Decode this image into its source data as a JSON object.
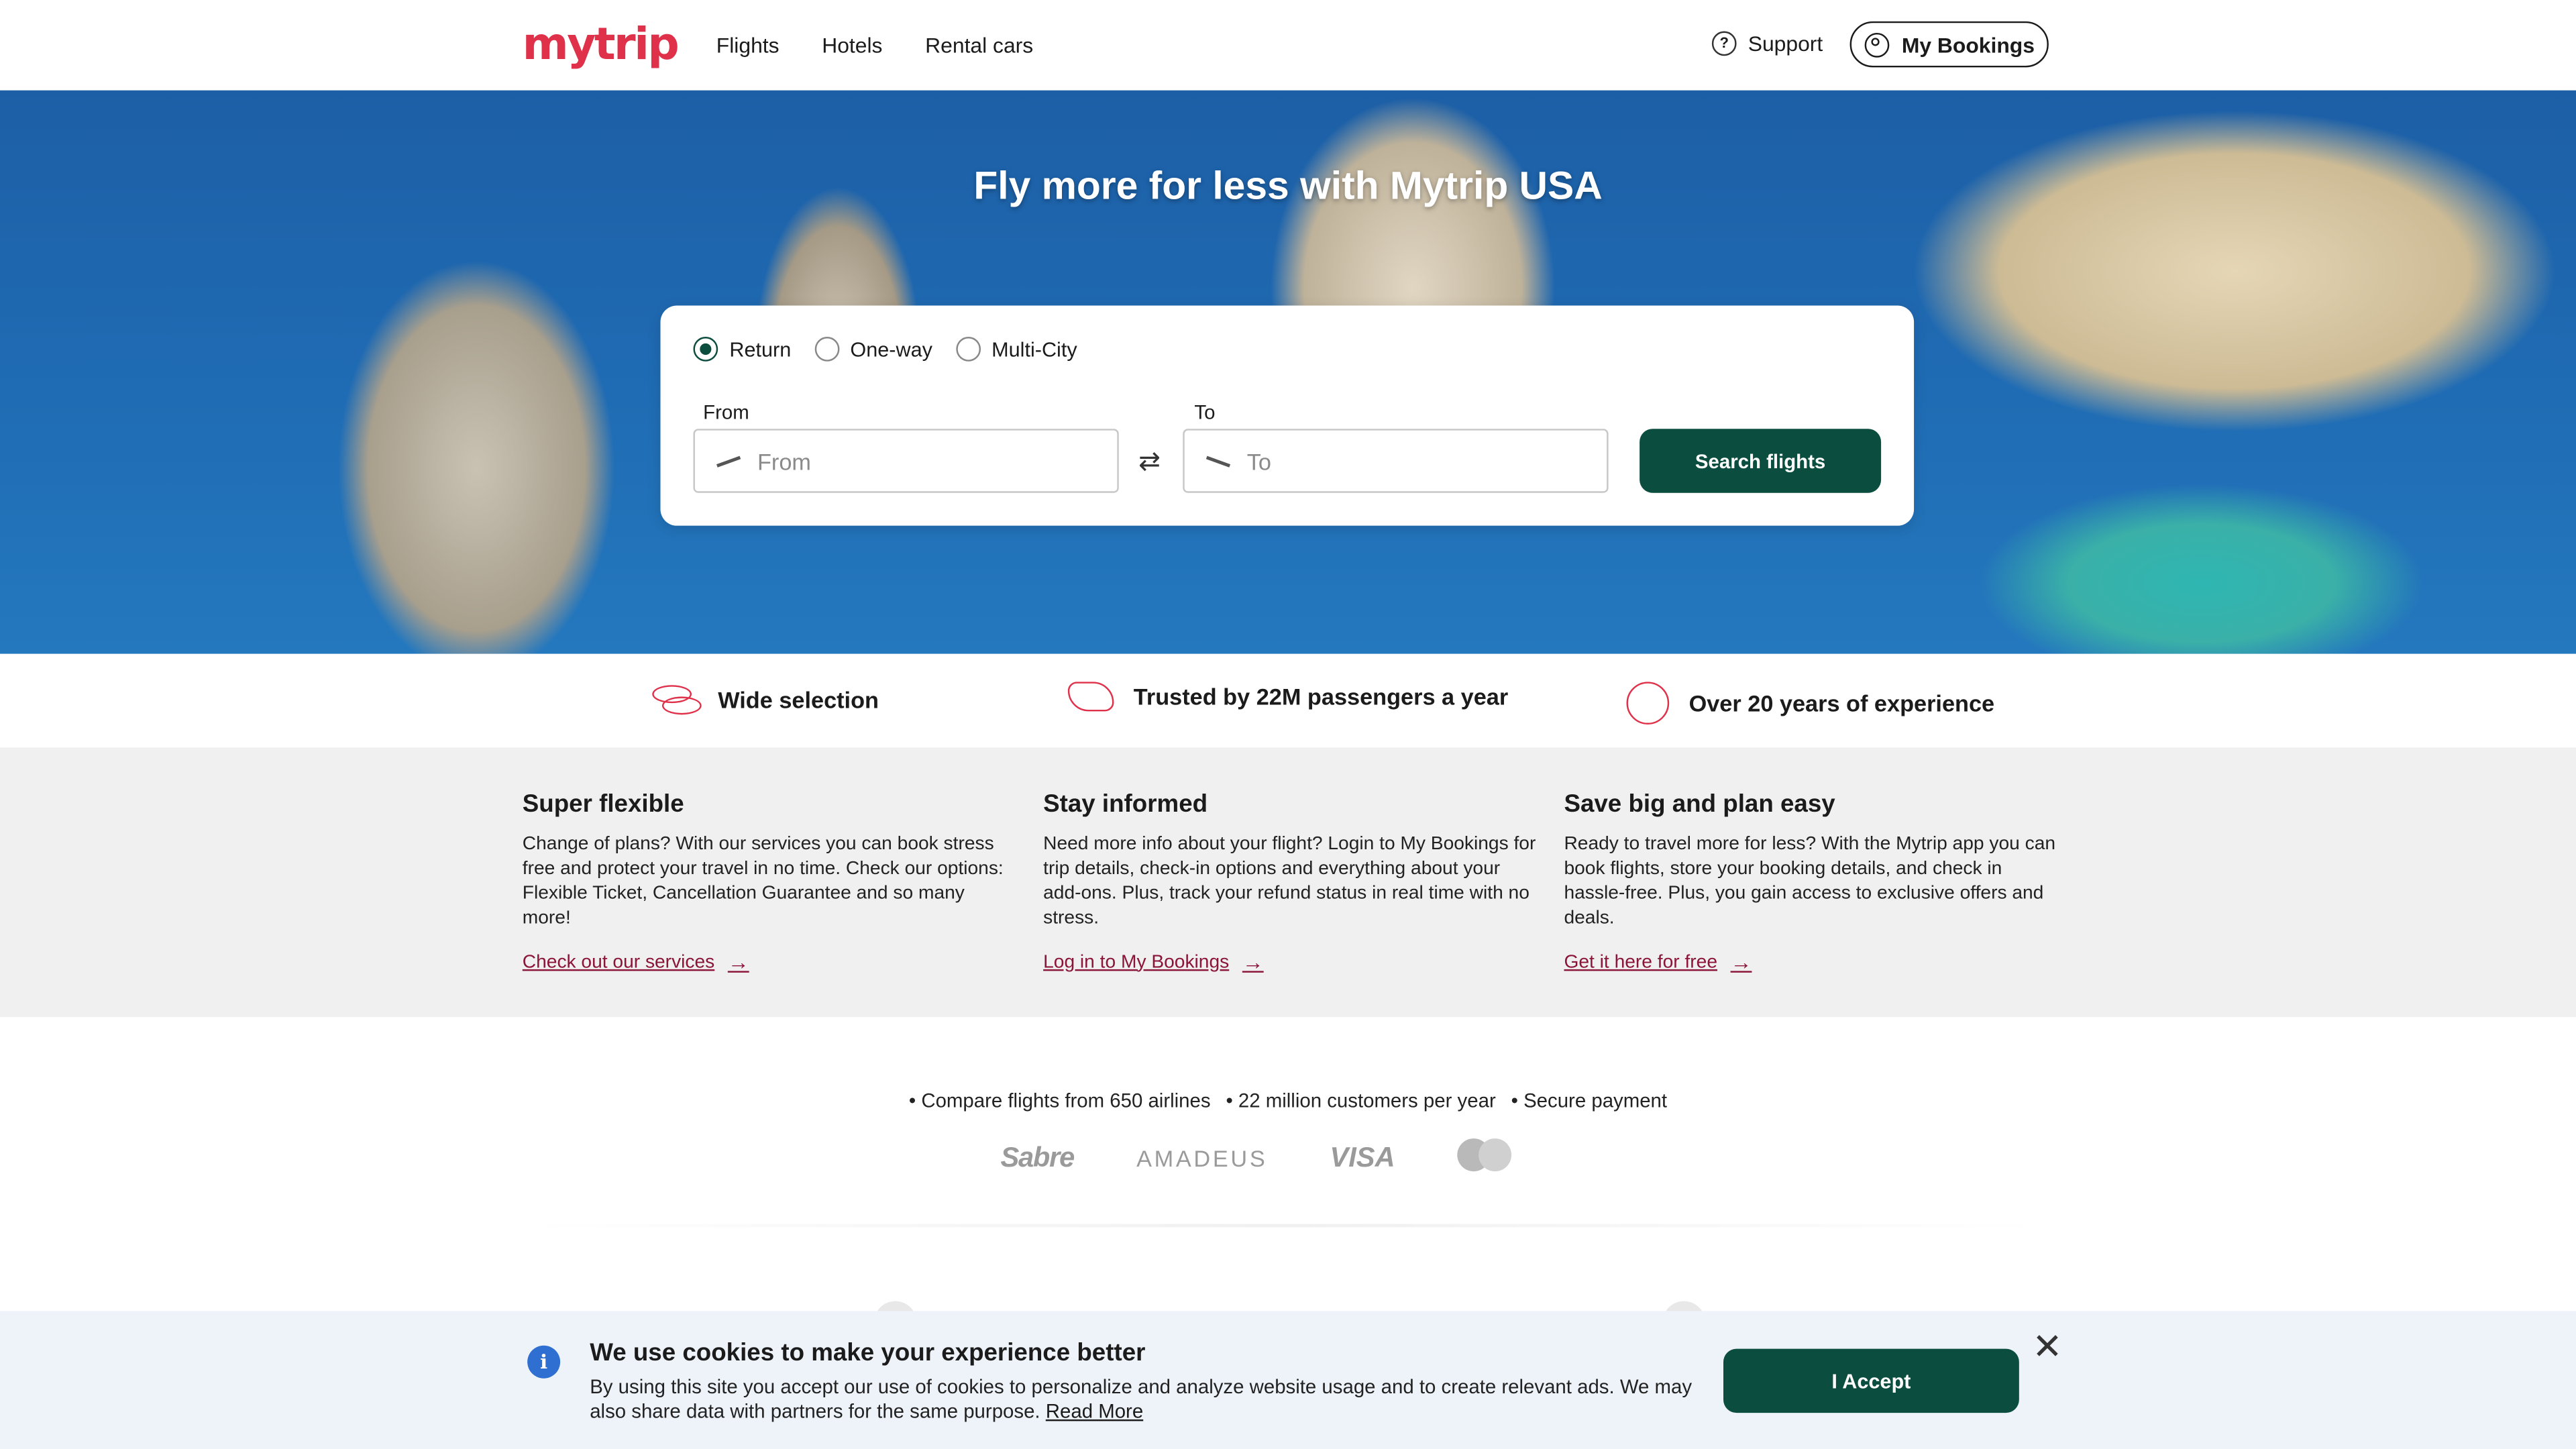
{
  "header": {
    "logo": "mytrip",
    "nav": [
      "Flights",
      "Hotels",
      "Rental cars"
    ],
    "support": "Support",
    "my_bookings": "My Bookings"
  },
  "hero": {
    "title": "Fly more for less with Mytrip USA"
  },
  "search": {
    "trip_types": [
      "Return",
      "One-way",
      "Multi-City"
    ],
    "selected_trip_type": "Return",
    "from_label": "From",
    "from_placeholder": "From",
    "to_label": "To",
    "to_placeholder": "To",
    "button": "Search flights"
  },
  "usps": [
    "Wide selection",
    "Trusted by 22M passengers a year",
    "Over 20 years of experience"
  ],
  "info": [
    {
      "title": "Super flexible",
      "text": "Change of plans? With our services you can book stress free and protect your travel in no time. Check our options: Flexible Ticket, Cancellation Guarantee and so many more!",
      "link": "Check out our services"
    },
    {
      "title": "Stay informed",
      "text": "Need more info about your flight? Login to My Bookings for trip details, check-in options and everything about your add-ons. Plus, track your refund status in real time with no stress.",
      "link": "Log in to My Bookings"
    },
    {
      "title": "Save big and plan easy",
      "text": "Ready to travel more for less? With the Mytrip app you can book flights, store your booking details, and check in hassle-free. Plus, you gain access to exclusive offers and deals.",
      "link": "Get it here for free"
    }
  ],
  "facts": [
    "• Compare flights from 650 airlines",
    "• 22 million customers per year",
    "• Secure payment"
  ],
  "partners": [
    "Sabre",
    "AMADEUS",
    "VISA",
    "mastercard"
  ],
  "cookie": {
    "title": "We use cookies to make your experience better",
    "text": "By using this site you accept our use of cookies to personalize and analyze website usage and to create relevant ads. We may also share data with partners for the same purpose.",
    "read_more": "Read More",
    "accept": "I Accept"
  },
  "colors": {
    "brand": "#e0314b",
    "primary_button": "#0b4d3f",
    "link": "#8a1538"
  }
}
